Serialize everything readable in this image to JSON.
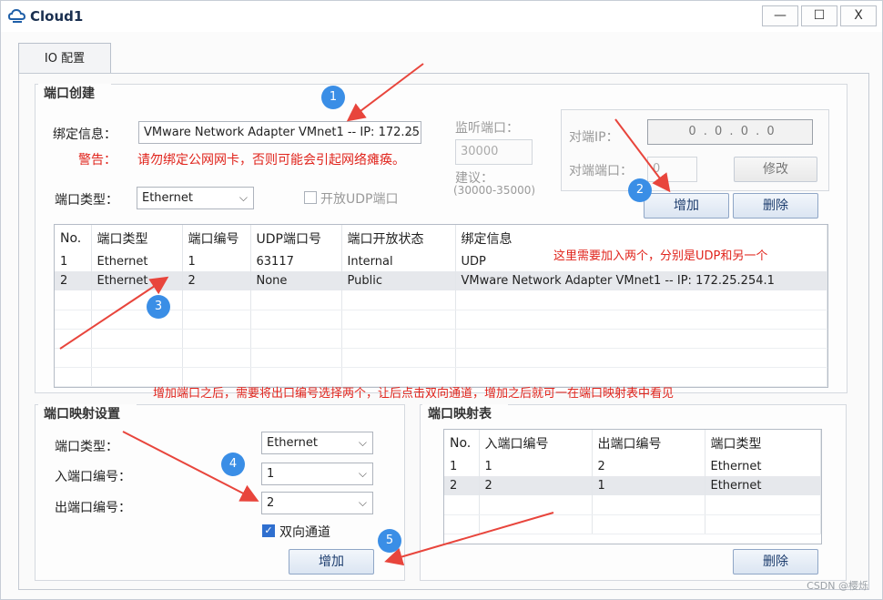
{
  "window": {
    "title": "Cloud1",
    "minimize": "—",
    "maximize": "☐",
    "close": "X"
  },
  "tab": {
    "label": "IO 配置"
  },
  "port_create": {
    "title": "端口创建",
    "bind_label": "绑定信息：",
    "bind_value": "VMware Network Adapter VMnet1 -- IP: 172.25",
    "warn_label": "警告：",
    "warn_text": "请勿绑定公网网卡，否则可能会引起网络瘫痪。",
    "port_type_label": "端口类型：",
    "port_type_value": "Ethernet",
    "udp_checkbox_label": "开放UDP端口",
    "listen_port_label": "监听端口：",
    "listen_port_value": "30000",
    "suggest_label": "建议：",
    "suggest_range": "(30000-35000)",
    "peer_ip_label": "对端IP：",
    "peer_ip_value": "0 . 0 . 0 . 0",
    "peer_port_label": "对端端口：",
    "peer_port_value": "0",
    "modify_button": "修改",
    "add_button": "增加",
    "delete_button": "删除"
  },
  "port_table": {
    "headers": [
      "No.",
      "端口类型",
      "端口编号",
      "UDP端口号",
      "端口开放状态",
      "绑定信息"
    ],
    "rows": [
      [
        "1",
        "Ethernet",
        "1",
        "63117",
        "Internal",
        "UDP"
      ],
      [
        "2",
        "Ethernet",
        "2",
        "None",
        "Public",
        "VMware Network Adapter VMnet1 -- IP: 172.25.254.1"
      ]
    ]
  },
  "mapping_settings": {
    "title": "端口映射设置",
    "port_type_label": "端口类型：",
    "port_type_value": "Ethernet",
    "in_port_label": "入端口编号：",
    "in_port_value": "1",
    "out_port_label": "出端口编号：",
    "out_port_value": "2",
    "bidirectional_label": "双向通道",
    "add_button": "增加"
  },
  "mapping_table": {
    "title": "端口映射表",
    "headers": [
      "No.",
      "入端口编号",
      "出端口编号",
      "端口类型"
    ],
    "rows": [
      [
        "1",
        "1",
        "2",
        "Ethernet"
      ],
      [
        "2",
        "2",
        "1",
        "Ethernet"
      ]
    ],
    "delete_button": "删除"
  },
  "annotations": {
    "note_top": "这里需要加入两个，分别是UDP和另一个",
    "note_middle": "增加端口之后，需要将出口编号选择两个，让后点击双向通道，增加之后就可一在端口映射表中看见",
    "markers": [
      "1",
      "2",
      "3",
      "4",
      "5"
    ],
    "color": "#e0241c"
  },
  "watermark": "CSDN @樱烁"
}
